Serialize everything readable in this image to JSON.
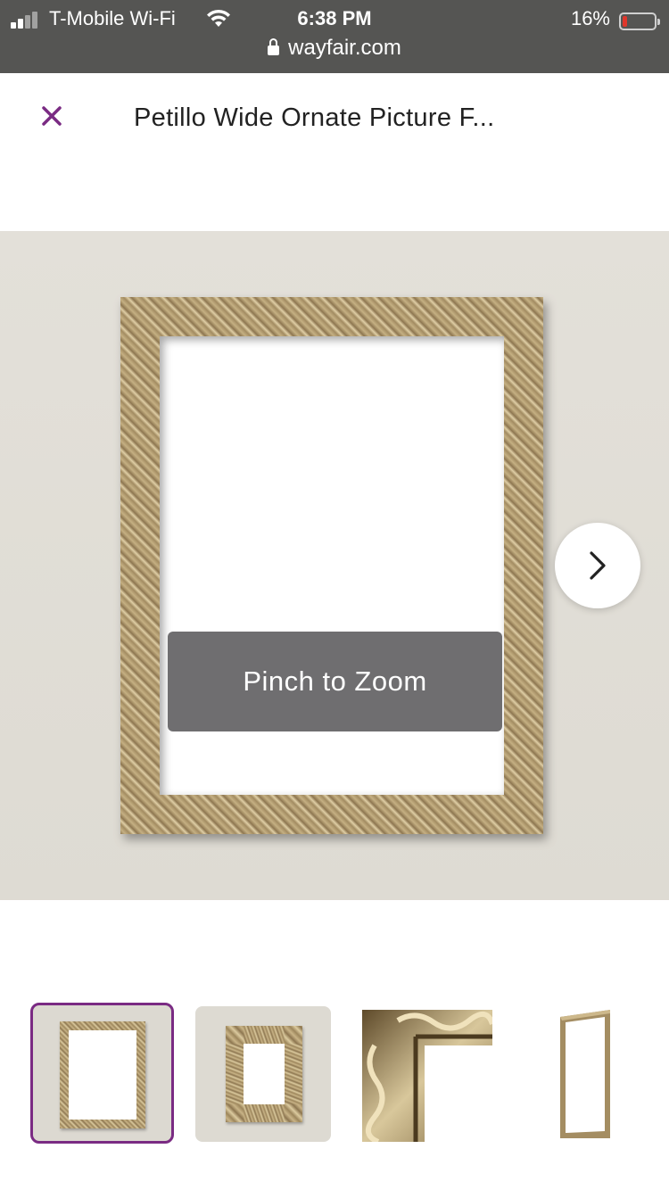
{
  "status_bar": {
    "carrier": "T-Mobile Wi-Fi",
    "time": "6:38 PM",
    "battery_percent": "16%",
    "battery_level": 0.16,
    "url": "wayfair.com"
  },
  "header": {
    "title": "Petillo Wide Ornate Picture F..."
  },
  "gallery": {
    "zoom_hint": "Pinch to Zoom",
    "selected_index": 0,
    "thumbnail_count": 4
  },
  "colors": {
    "accent": "#7a2b83",
    "status_bar_bg": "#555553",
    "toast_bg": "#6f6e70"
  },
  "icons": [
    "signal-icon",
    "wifi-icon",
    "lock-icon",
    "battery-icon",
    "close-icon",
    "chevron-right-icon"
  ]
}
